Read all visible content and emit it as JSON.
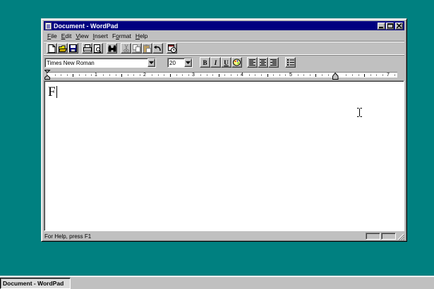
{
  "window": {
    "title": "Document - WordPad"
  },
  "menu": [
    {
      "label": "File",
      "mn": "F",
      "rest": "ile"
    },
    {
      "label": "Edit",
      "mn": "E",
      "rest": "dit"
    },
    {
      "label": "View",
      "mn": "V",
      "rest": "iew"
    },
    {
      "label": "Insert",
      "mn": "I",
      "rest": "nsert"
    },
    {
      "label": "Format",
      "mn": "o",
      "pre": "F",
      "rest": "rmat"
    },
    {
      "label": "Help",
      "mn": "H",
      "rest": "elp"
    }
  ],
  "format_bar": {
    "font_name": "Times New Roman",
    "font_size": "20",
    "bold_label": "B",
    "italic_label": "I",
    "underline_label": "U"
  },
  "ruler": {
    "numbers": [
      "1",
      "2",
      "3",
      "4",
      "5",
      "7"
    ]
  },
  "document": {
    "text": "F"
  },
  "status": {
    "help_text": "For Help, press F1"
  },
  "taskbar": {
    "task_label": "Document - WordPad"
  },
  "colors": {
    "desktop": "#008080",
    "titlebar": "#000080",
    "face": "#c0c0c0"
  }
}
